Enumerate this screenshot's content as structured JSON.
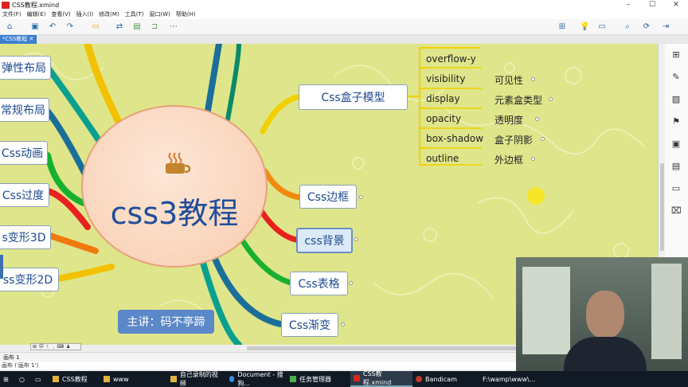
{
  "window": {
    "title": "CSS教程.xmind",
    "controls": [
      "–",
      "☐",
      "✕"
    ]
  },
  "menu": [
    "文件(F)",
    "编辑(E)",
    "查看(V)",
    "插入(I)",
    "修改(M)",
    "工具(T)",
    "窗口(W)",
    "帮助(H)"
  ],
  "tab": {
    "label": "*CSS教程 ✕"
  },
  "central": {
    "title": "css3教程"
  },
  "left_nodes": [
    "弹性布局",
    "常规布局",
    "Css动画",
    "Css过度",
    "s变形3D",
    "ss变形2D"
  ],
  "right_nodes": [
    "Css盒子模型",
    "Css边框",
    "css背景",
    "Css表格",
    "Css渐变"
  ],
  "box_model_children": [
    {
      "prop": "overflow-y",
      "note": ""
    },
    {
      "prop": "visibility",
      "note": "可见性"
    },
    {
      "prop": "display",
      "note": "元素盒类型"
    },
    {
      "prop": "opacity",
      "note": "透明度"
    },
    {
      "prop": "box-shadow",
      "note": "盒子阴影"
    },
    {
      "prop": "outline",
      "note": "外边框"
    }
  ],
  "speaker": "主讲：码不亭蹄",
  "sheet": "画布 1",
  "status": "画布 ('画布 1')",
  "taskbar": [
    "CSS教程",
    "www",
    "自己录制的视频",
    "Document - 搜狗...",
    "任务管理器",
    "CSS教程.xmind",
    "Bandicam",
    "F:\\wamp\\www\\..."
  ],
  "colors": {
    "canvas": "#dfe58a",
    "accent": "#3a7fd0",
    "central_text": "#1f4e9a"
  },
  "icons": [
    "home-icon",
    "save-icon",
    "undo-icon",
    "redo-icon",
    "search-icon",
    "lightbulb-icon",
    "share-icon",
    "flag-icon",
    "image-icon",
    "note-icon",
    "tag-icon"
  ]
}
